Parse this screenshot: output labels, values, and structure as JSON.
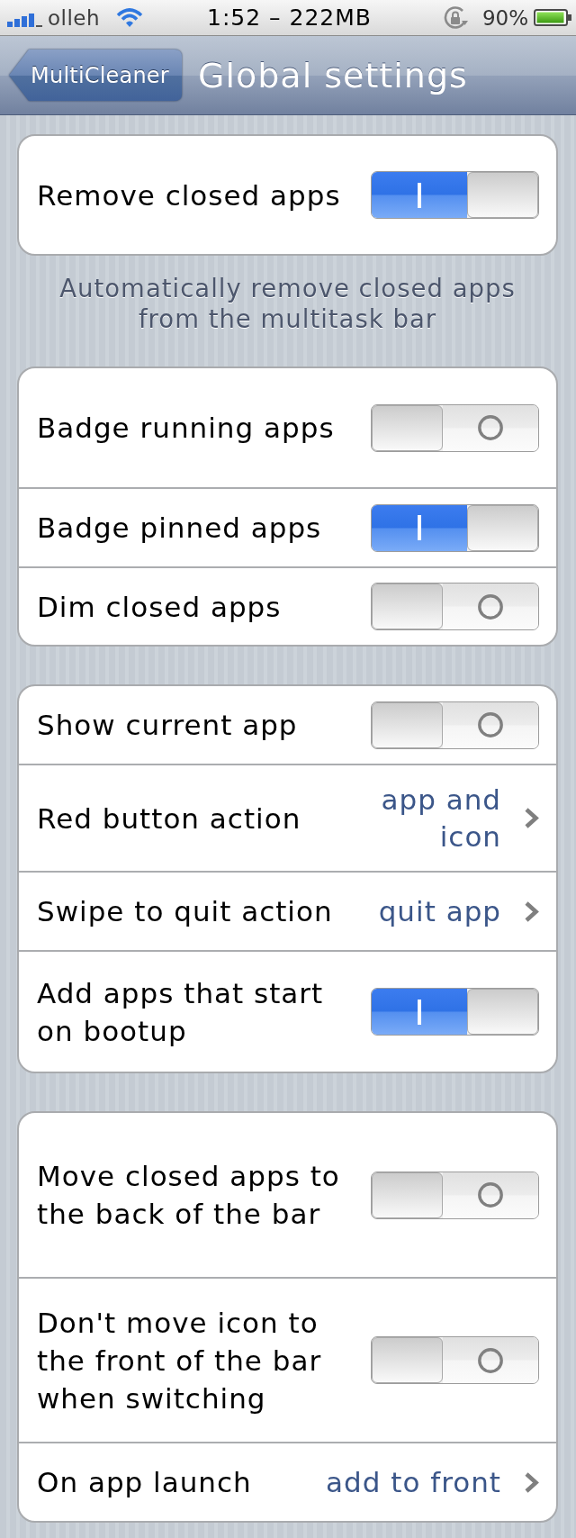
{
  "status_bar": {
    "carrier": "olleh",
    "time": "1:52 – 222MB",
    "battery": "90%"
  },
  "nav_bar": {
    "back_button": "MultiCleaner",
    "title": "Global settings"
  },
  "groups": [
    {
      "rows": [
        {
          "kind": "toggle",
          "label": "Remove closed apps",
          "on": true
        }
      ],
      "footer": "Automatically remove closed apps from the multitask bar"
    },
    {
      "rows": [
        {
          "kind": "toggle",
          "label": "Badge running apps",
          "on": false
        },
        {
          "kind": "toggle",
          "label": "Badge pinned apps",
          "on": true
        },
        {
          "kind": "toggle",
          "label": "Dim closed apps",
          "on": false
        }
      ]
    },
    {
      "rows": [
        {
          "kind": "toggle",
          "label": "Show current app",
          "on": false
        },
        {
          "kind": "choice",
          "label": "Red button action",
          "value": "app and icon"
        },
        {
          "kind": "choice",
          "label": "Swipe to quit action",
          "value": "quit app"
        },
        {
          "kind": "toggle",
          "label": "Add apps that start on bootup",
          "on": true
        }
      ]
    },
    {
      "rows": [
        {
          "kind": "toggle",
          "label": "Move closed apps to the back of the bar",
          "on": false
        },
        {
          "kind": "toggle",
          "label": "Don't move icon to the front of the bar when switching",
          "on": false
        },
        {
          "kind": "choice",
          "label": "On app launch",
          "value": "add to front"
        }
      ]
    }
  ]
}
